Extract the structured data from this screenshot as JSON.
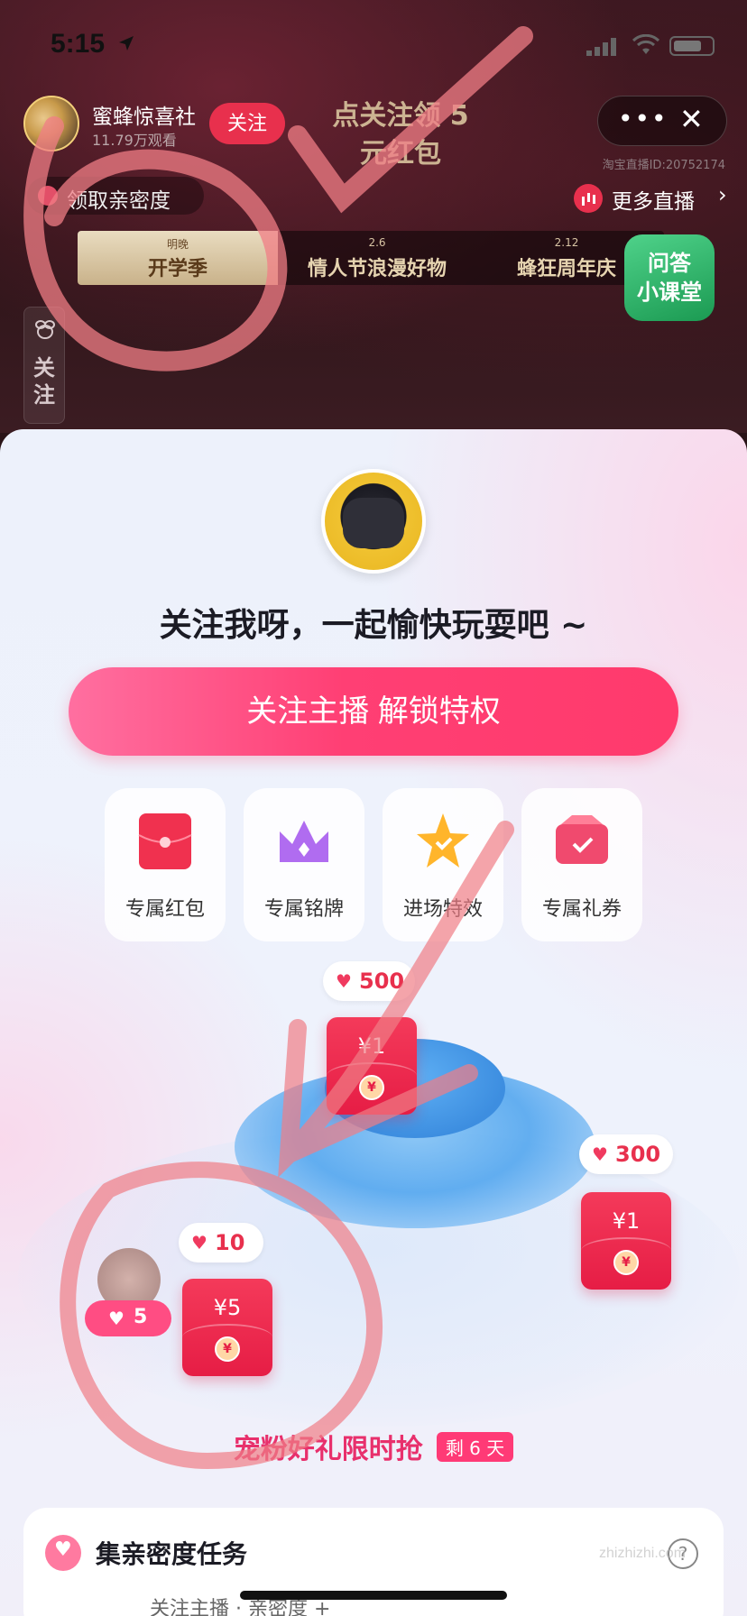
{
  "status_bar": {
    "time": "5:15"
  },
  "host": {
    "name": "蜜蜂惊喜社",
    "viewers": "11.79万观看",
    "follow_label": "关注",
    "live_id": "淘宝直播ID:20752174"
  },
  "promo_overlay": "点关注领 5元红包",
  "top_controls": {
    "more_label": "•••",
    "close_label": "✕"
  },
  "intimacy_chip": {
    "label": "领取亲密度"
  },
  "more_live": {
    "label": "更多直播"
  },
  "events": [
    {
      "date": "明晚",
      "name": "开学季"
    },
    {
      "date": "2.6",
      "name": "情人节浪漫好物"
    },
    {
      "date": "2.12",
      "name": "蜂狂周年庆"
    }
  ],
  "qa_badge": {
    "line1": "问答",
    "line2": "小课堂"
  },
  "side_follow": {
    "label": "关注"
  },
  "sheet": {
    "title": "关注我呀，一起愉快玩耍吧 ~",
    "main_button": "关注主播 解锁特权",
    "perks": [
      {
        "label": "专属红包",
        "icon": "red-envelope-icon"
      },
      {
        "label": "专属铭牌",
        "icon": "crown-icon"
      },
      {
        "label": "进场特效",
        "icon": "star-icon"
      },
      {
        "label": "专属礼券",
        "icon": "coupon-icon"
      }
    ],
    "rewards": [
      {
        "hearts": "500",
        "amount": "¥1"
      },
      {
        "hearts": "300",
        "amount": "¥1"
      },
      {
        "hearts": "10",
        "amount": "¥5"
      }
    ],
    "user_hearts": "5",
    "promo_title": "宠粉好礼限时抢",
    "days_left": "剩 6 天",
    "task_title": "集亲密度任务",
    "task_peek": "关注主播 · 亲密度 +"
  },
  "watermark": "zhizhizhi.com",
  "colors": {
    "brand_red": "#e8304d",
    "button_pink": "#ff3f74",
    "qa_green": "#1b9a52"
  }
}
